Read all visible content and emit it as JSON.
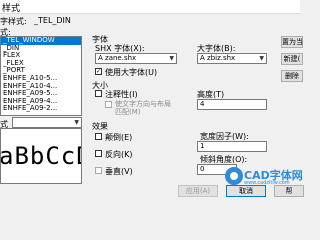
{
  "window": {
    "title": "样式"
  },
  "current_style": {
    "label": "字样式:",
    "value": "_TEL_DIN"
  },
  "styles_label": "式:",
  "styles_list": [
    "_TEL_WINDOW",
    "_DIN",
    "FLEX",
    "_FLEX",
    "_PORT",
    "ENHFE_A10-5...",
    "ENHFE_A10-4...",
    "ENHFE_A09-5...",
    "ENHFE_A09-4...",
    "ENHFE_A09-2..."
  ],
  "filter": {
    "label": "式",
    "value": ""
  },
  "preview_text": "aBbCcD",
  "font_section": {
    "title": "字体",
    "shx_label": "SHX 字体(X):",
    "shx_value": "A zane.shx",
    "big_label": "大字体(B):",
    "big_value": "A zbiz.shx",
    "use_bigfont_label": "使用大字体(U)",
    "use_bigfont_checked": true
  },
  "size_section": {
    "title": "大小",
    "annotative_label": "注释性(I)",
    "match_label_line1": "使文字方向与布局",
    "match_label_line2": "匹配(M)",
    "height_label": "高度(T)",
    "height_value": "4"
  },
  "effects_section": {
    "title": "效果",
    "upside_down_label": "颠倒(E)",
    "backwards_label": "反向(K)",
    "vertical_label": "垂直(V)",
    "width_label": "宽度因子(W):",
    "width_value": "1",
    "oblique_label": "倾斜角度(O):",
    "oblique_value": "0"
  },
  "buttons": {
    "set_current": "置为当",
    "new": "新建(",
    "delete": "删除",
    "apply": "应用(A)",
    "cancel": "取消",
    "help": "帮"
  },
  "watermark": {
    "brand": "CAD字体网",
    "url": "www.cadzitiw.com"
  },
  "colors": {
    "selection": "#0078d7",
    "watermark": "#2e8bd8"
  }
}
